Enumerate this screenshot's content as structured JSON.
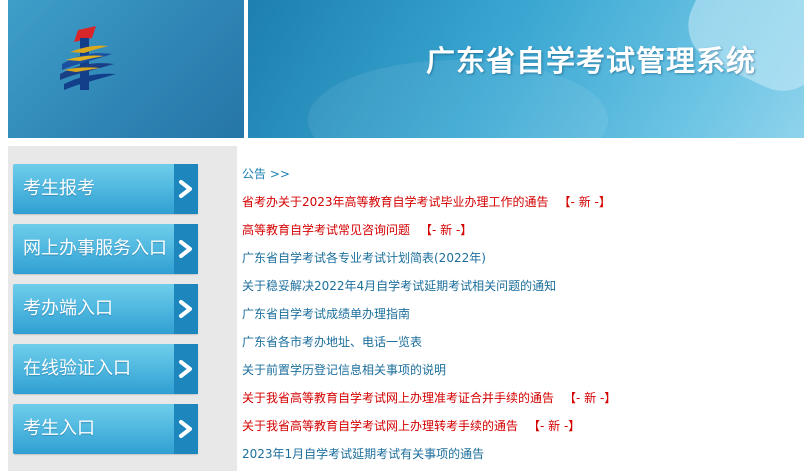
{
  "header": {
    "title": "广东省自学考试管理系统",
    "logo": "exam-system-logo"
  },
  "sidebar": {
    "items": [
      {
        "label": "考生报考",
        "icon": "chevron-right-icon"
      },
      {
        "label": "网上办事服务入口",
        "icon": "chevron-right-icon"
      },
      {
        "label": "考办端入口",
        "icon": "chevron-right-icon"
      },
      {
        "label": "在线验证入口",
        "icon": "chevron-right-icon"
      },
      {
        "label": "考生入口",
        "icon": "chevron-right-icon"
      }
    ]
  },
  "content": {
    "breadcrumb": "公告 >>",
    "notices": [
      {
        "text": "省考办关于2023年高等教育自学考试毕业办理工作的通告",
        "tag": "【- 新 -】",
        "style": "red"
      },
      {
        "text": "高等教育自学考试常见咨询问题",
        "tag": "【- 新 -】",
        "style": "red"
      },
      {
        "text": "广东省自学考试各专业考试计划简表(2022年)",
        "tag": "",
        "style": "blue"
      },
      {
        "text": "关于稳妥解决2022年4月自学考试延期考试相关问题的通知",
        "tag": "",
        "style": "blue"
      },
      {
        "text": "广东省自学考试成绩单办理指南",
        "tag": "",
        "style": "blue"
      },
      {
        "text": "广东省各市考办地址、电话一览表",
        "tag": "",
        "style": "blue"
      },
      {
        "text": "关于前置学历登记信息相关事项的说明",
        "tag": "",
        "style": "blue"
      },
      {
        "text": "关于我省高等教育自学考试网上办理准考证合并手续的通告",
        "tag": "【- 新 -】",
        "style": "red"
      },
      {
        "text": "关于我省高等教育自学考试网上办理转考手续的通告",
        "tag": "【- 新 -】",
        "style": "red"
      },
      {
        "text": "2023年1月自学考试延期考试有关事项的通告",
        "tag": "",
        "style": "blue"
      }
    ]
  },
  "colors": {
    "accent_blue": "#2f9fd2",
    "new_tag_red": "#d40000",
    "link_blue": "#1c6f9c"
  }
}
